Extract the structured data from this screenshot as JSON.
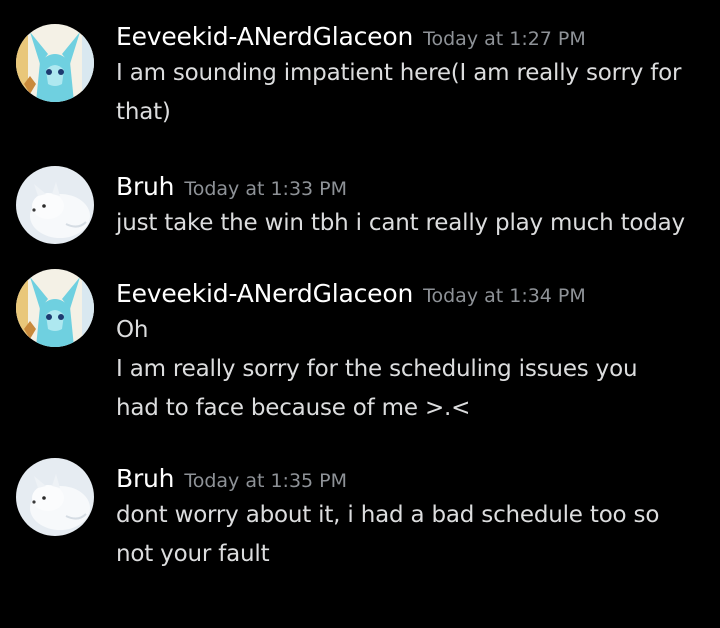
{
  "messages": [
    {
      "author": "Eeveekid-ANerdGlaceon",
      "timestamp": "Today at 1:27 PM",
      "avatar_icon": "glaceon-avatar-icon",
      "lines": [
        "I am sounding impatient here(I am really sorry for",
        "that)"
      ]
    },
    {
      "author": "Bruh",
      "timestamp": "Today at 1:33 PM",
      "avatar_icon": "arctic-fox-avatar-icon",
      "lines": [
        "just take the win tbh i cant really play much today"
      ]
    },
    {
      "author": "Eeveekid-ANerdGlaceon",
      "timestamp": "Today at 1:34 PM",
      "avatar_icon": "glaceon-avatar-icon",
      "lines": [
        "Oh",
        "I am really sorry for the scheduling issues you",
        "had to face because of me >.<"
      ]
    },
    {
      "author": "Bruh",
      "timestamp": "Today at 1:35 PM",
      "avatar_icon": "arctic-fox-avatar-icon",
      "lines": [
        "dont worry about it, i had a bad schedule too so",
        "not your fault"
      ]
    }
  ],
  "colors": {
    "background": "#000000",
    "username": "#ffffff",
    "timestamp": "#8e9297",
    "message_text": "#dcddde"
  }
}
